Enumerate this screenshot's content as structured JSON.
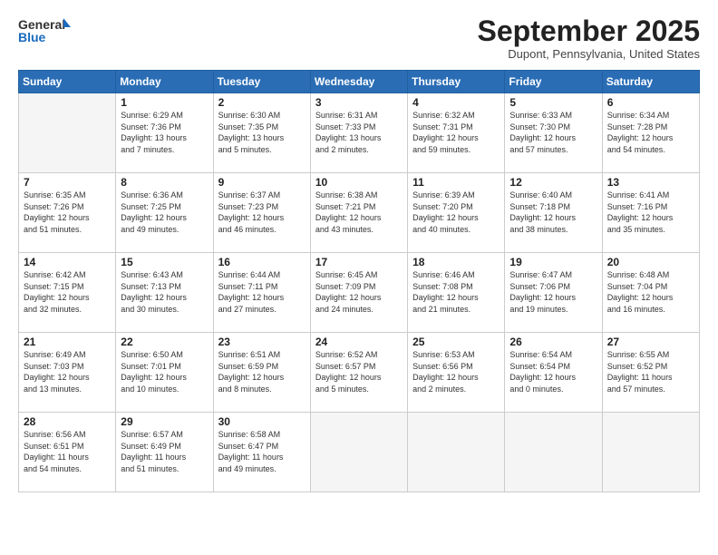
{
  "header": {
    "logo_general": "General",
    "logo_blue": "Blue",
    "month": "September 2025",
    "location": "Dupont, Pennsylvania, United States"
  },
  "days_of_week": [
    "Sunday",
    "Monday",
    "Tuesday",
    "Wednesday",
    "Thursday",
    "Friday",
    "Saturday"
  ],
  "weeks": [
    [
      {
        "day": "",
        "info": ""
      },
      {
        "day": "1",
        "info": "Sunrise: 6:29 AM\nSunset: 7:36 PM\nDaylight: 13 hours\nand 7 minutes."
      },
      {
        "day": "2",
        "info": "Sunrise: 6:30 AM\nSunset: 7:35 PM\nDaylight: 13 hours\nand 5 minutes."
      },
      {
        "day": "3",
        "info": "Sunrise: 6:31 AM\nSunset: 7:33 PM\nDaylight: 13 hours\nand 2 minutes."
      },
      {
        "day": "4",
        "info": "Sunrise: 6:32 AM\nSunset: 7:31 PM\nDaylight: 12 hours\nand 59 minutes."
      },
      {
        "day": "5",
        "info": "Sunrise: 6:33 AM\nSunset: 7:30 PM\nDaylight: 12 hours\nand 57 minutes."
      },
      {
        "day": "6",
        "info": "Sunrise: 6:34 AM\nSunset: 7:28 PM\nDaylight: 12 hours\nand 54 minutes."
      }
    ],
    [
      {
        "day": "7",
        "info": "Sunrise: 6:35 AM\nSunset: 7:26 PM\nDaylight: 12 hours\nand 51 minutes."
      },
      {
        "day": "8",
        "info": "Sunrise: 6:36 AM\nSunset: 7:25 PM\nDaylight: 12 hours\nand 49 minutes."
      },
      {
        "day": "9",
        "info": "Sunrise: 6:37 AM\nSunset: 7:23 PM\nDaylight: 12 hours\nand 46 minutes."
      },
      {
        "day": "10",
        "info": "Sunrise: 6:38 AM\nSunset: 7:21 PM\nDaylight: 12 hours\nand 43 minutes."
      },
      {
        "day": "11",
        "info": "Sunrise: 6:39 AM\nSunset: 7:20 PM\nDaylight: 12 hours\nand 40 minutes."
      },
      {
        "day": "12",
        "info": "Sunrise: 6:40 AM\nSunset: 7:18 PM\nDaylight: 12 hours\nand 38 minutes."
      },
      {
        "day": "13",
        "info": "Sunrise: 6:41 AM\nSunset: 7:16 PM\nDaylight: 12 hours\nand 35 minutes."
      }
    ],
    [
      {
        "day": "14",
        "info": "Sunrise: 6:42 AM\nSunset: 7:15 PM\nDaylight: 12 hours\nand 32 minutes."
      },
      {
        "day": "15",
        "info": "Sunrise: 6:43 AM\nSunset: 7:13 PM\nDaylight: 12 hours\nand 30 minutes."
      },
      {
        "day": "16",
        "info": "Sunrise: 6:44 AM\nSunset: 7:11 PM\nDaylight: 12 hours\nand 27 minutes."
      },
      {
        "day": "17",
        "info": "Sunrise: 6:45 AM\nSunset: 7:09 PM\nDaylight: 12 hours\nand 24 minutes."
      },
      {
        "day": "18",
        "info": "Sunrise: 6:46 AM\nSunset: 7:08 PM\nDaylight: 12 hours\nand 21 minutes."
      },
      {
        "day": "19",
        "info": "Sunrise: 6:47 AM\nSunset: 7:06 PM\nDaylight: 12 hours\nand 19 minutes."
      },
      {
        "day": "20",
        "info": "Sunrise: 6:48 AM\nSunset: 7:04 PM\nDaylight: 12 hours\nand 16 minutes."
      }
    ],
    [
      {
        "day": "21",
        "info": "Sunrise: 6:49 AM\nSunset: 7:03 PM\nDaylight: 12 hours\nand 13 minutes."
      },
      {
        "day": "22",
        "info": "Sunrise: 6:50 AM\nSunset: 7:01 PM\nDaylight: 12 hours\nand 10 minutes."
      },
      {
        "day": "23",
        "info": "Sunrise: 6:51 AM\nSunset: 6:59 PM\nDaylight: 12 hours\nand 8 minutes."
      },
      {
        "day": "24",
        "info": "Sunrise: 6:52 AM\nSunset: 6:57 PM\nDaylight: 12 hours\nand 5 minutes."
      },
      {
        "day": "25",
        "info": "Sunrise: 6:53 AM\nSunset: 6:56 PM\nDaylight: 12 hours\nand 2 minutes."
      },
      {
        "day": "26",
        "info": "Sunrise: 6:54 AM\nSunset: 6:54 PM\nDaylight: 12 hours\nand 0 minutes."
      },
      {
        "day": "27",
        "info": "Sunrise: 6:55 AM\nSunset: 6:52 PM\nDaylight: 11 hours\nand 57 minutes."
      }
    ],
    [
      {
        "day": "28",
        "info": "Sunrise: 6:56 AM\nSunset: 6:51 PM\nDaylight: 11 hours\nand 54 minutes."
      },
      {
        "day": "29",
        "info": "Sunrise: 6:57 AM\nSunset: 6:49 PM\nDaylight: 11 hours\nand 51 minutes."
      },
      {
        "day": "30",
        "info": "Sunrise: 6:58 AM\nSunset: 6:47 PM\nDaylight: 11 hours\nand 49 minutes."
      },
      {
        "day": "",
        "info": ""
      },
      {
        "day": "",
        "info": ""
      },
      {
        "day": "",
        "info": ""
      },
      {
        "day": "",
        "info": ""
      }
    ]
  ]
}
